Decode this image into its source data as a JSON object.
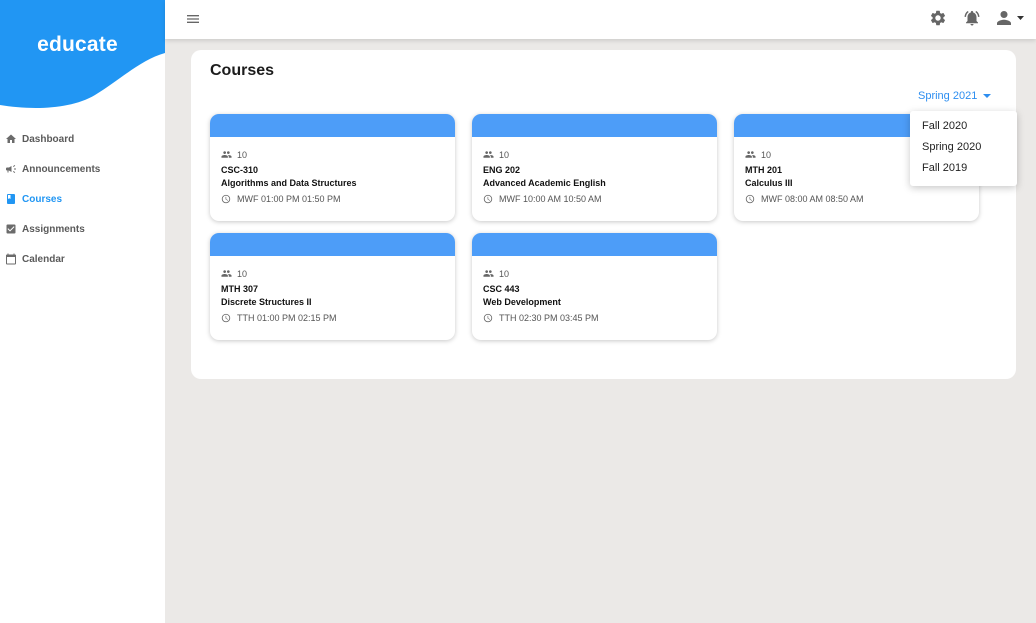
{
  "brand": {
    "name": "educate",
    "color": "#2196f3"
  },
  "sidebar": {
    "items": [
      {
        "label": "Dashboard",
        "icon": "home-icon",
        "active": false
      },
      {
        "label": "Announcements",
        "icon": "megaphone-icon",
        "active": false
      },
      {
        "label": "Courses",
        "icon": "book-icon",
        "active": true
      },
      {
        "label": "Assignments",
        "icon": "checkbox-icon",
        "active": false
      },
      {
        "label": "Calendar",
        "icon": "calendar-icon",
        "active": false
      }
    ]
  },
  "topbar": {
    "menu_icon": "menu-icon",
    "right_icons": [
      "settings-gear-icon",
      "notification-bell-icon",
      "user-account-icon"
    ]
  },
  "main": {
    "title": "Courses",
    "term_select": {
      "value": "Spring 2021"
    },
    "courses": [
      {
        "students": "10",
        "code": "CSC-310",
        "name": "Algorithms and Data Structures",
        "schedule": "MWF 01:00 PM 01:50 PM"
      },
      {
        "students": "10",
        "code": "ENG 202",
        "name": "Advanced Academic English",
        "schedule": "MWF 10:00 AM 10:50 AM"
      },
      {
        "students": "10",
        "code": "MTH 201",
        "name": "Calculus III",
        "schedule": "MWF 08:00 AM 08:50 AM"
      },
      {
        "students": "10",
        "code": "MTH 307",
        "name": "Discrete Structures II",
        "schedule": "TTH 01:00 PM 02:15 PM"
      },
      {
        "students": "10",
        "code": "CSC 443",
        "name": "Web Development",
        "schedule": "TTH 02:30 PM 03:45 PM"
      }
    ]
  },
  "dropdown": {
    "options": [
      "Fall 2020",
      "Spring 2020",
      "Fall 2019"
    ]
  },
  "colors": {
    "accent": "#2196f3",
    "card_band": "#4d9df8",
    "background": "#ebe9e7"
  }
}
